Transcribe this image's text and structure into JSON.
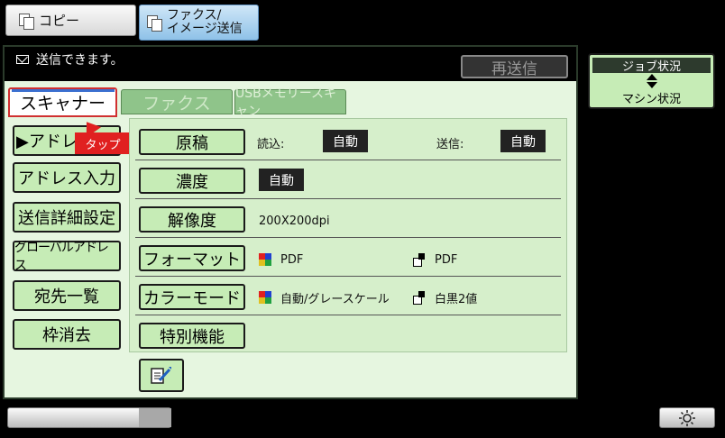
{
  "modes": {
    "copy_label": "コピー",
    "fax_label_line1": "ファクス/",
    "fax_label_line2": "イメージ送信"
  },
  "status": {
    "message": "送信できます。",
    "resend_label": "再送信"
  },
  "tabs": [
    {
      "label": "スキャナー",
      "active": true
    },
    {
      "label": "ファクス",
      "active": false
    },
    {
      "label": "USBメモリースキャン",
      "active": false
    }
  ],
  "left_menu": [
    {
      "label": "▶アドレス帳"
    },
    {
      "label": "アドレス入力"
    },
    {
      "label": "送信詳細設定"
    },
    {
      "label": "グローバルアドレス"
    },
    {
      "label": "宛先一覧"
    },
    {
      "label": "枠消去"
    }
  ],
  "tap_hint": "タップ",
  "settings": {
    "original": {
      "label": "原稿",
      "read_label": "読込:",
      "read_value": "自動",
      "send_label": "送信:",
      "send_value": "自動"
    },
    "density": {
      "label": "濃度",
      "value": "自動"
    },
    "resolution": {
      "label": "解像度",
      "value": "200X200dpi"
    },
    "format": {
      "label": "フォーマット",
      "color_value": "PDF",
      "bw_value": "PDF"
    },
    "color_mode": {
      "label": "カラーモード",
      "color_value": "自動/グレースケール",
      "bw_value": "白黒2値"
    },
    "special": {
      "label": "特別機能"
    }
  },
  "job_status": {
    "top_label": "ジョブ状況",
    "bottom_label": "マシン状況"
  },
  "colors": {
    "panel_bg": "#e6f6e0",
    "button_bg": "#c6ecb6",
    "accent_red": "#e02020"
  }
}
